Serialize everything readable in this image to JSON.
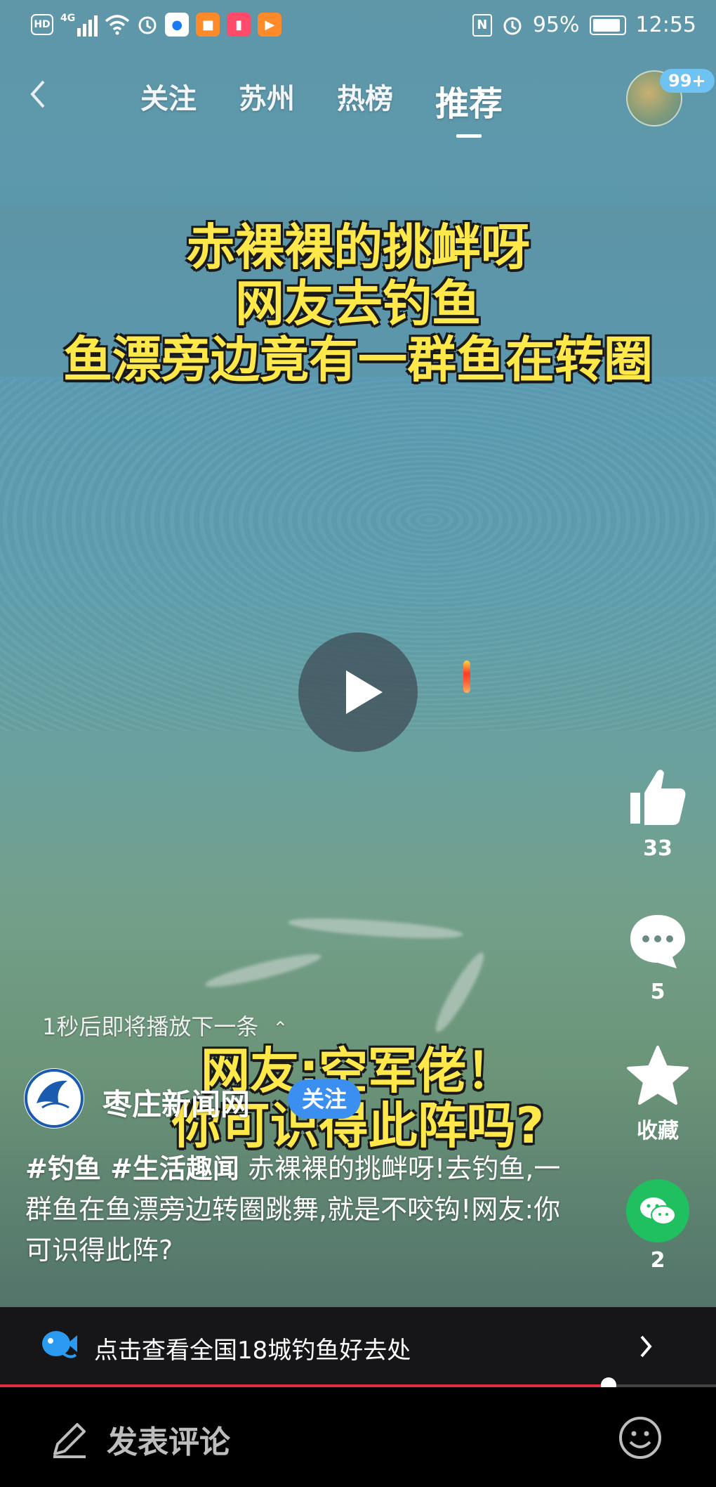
{
  "status_bar": {
    "left_icons": [
      "hd-icon",
      "signal-4g-icon",
      "wifi-icon",
      "alarm-icon",
      "bulb-app-icon",
      "game-app-icon",
      "book-app-icon",
      "video-app-icon"
    ],
    "hd": "HD",
    "network": "4G",
    "battery": "95%",
    "time": "12:55"
  },
  "nav": {
    "tabs": [
      {
        "label": "关注"
      },
      {
        "label": "苏州"
      },
      {
        "label": "热榜"
      },
      {
        "label": "推荐",
        "active": true
      }
    ],
    "badge": "99+"
  },
  "video": {
    "caption_top": [
      "赤裸裸的挑衅呀",
      "网友去钓鱼",
      "鱼漂旁边竟有一群鱼在转圈"
    ],
    "caption_bottom": [
      "网友:空军佬！",
      "你可识得此阵吗?"
    ]
  },
  "actions": {
    "like_count": "33",
    "comment_count": "5",
    "favorite_label": "收藏",
    "share_count": "2"
  },
  "next_hint": "1秒后即将播放下一条",
  "author": {
    "name": "枣庄新闻网",
    "follow_label": "关注"
  },
  "description": {
    "tags": "#钓鱼 #生活趣闻",
    "text": " 赤裸裸的挑衅呀!去钓鱼,一群鱼在鱼漂旁边转圈跳舞,就是不咬钩!网友:你可识得此阵?"
  },
  "promo": {
    "text": "点击查看全国18城钓鱼好去处"
  },
  "progress": 0.85,
  "comment_bar": {
    "placeholder": "发表评论"
  }
}
